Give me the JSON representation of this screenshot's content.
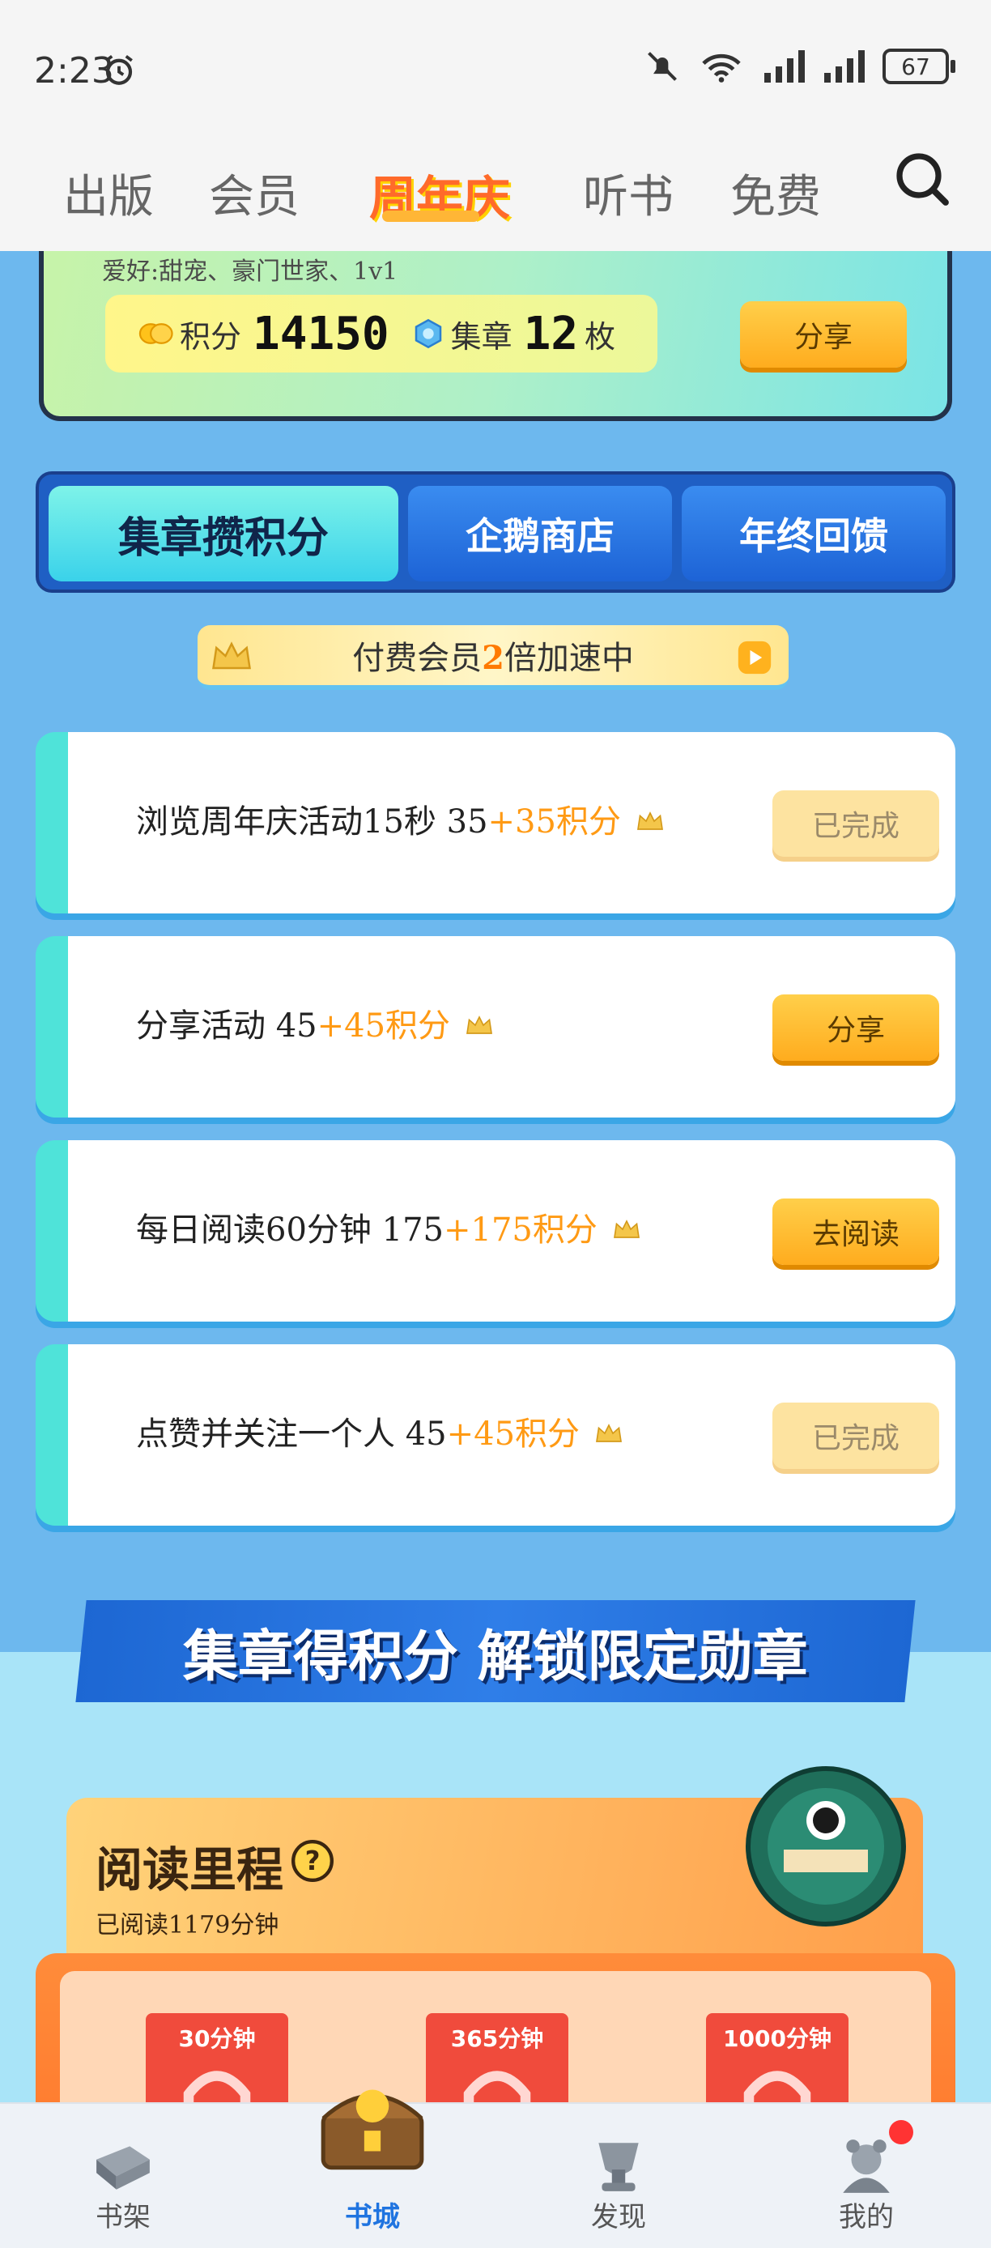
{
  "status_bar": {
    "time": "2:23",
    "battery": "67"
  },
  "top_nav": {
    "items": [
      "出版",
      "会员",
      "周年庆",
      "听书",
      "免费"
    ],
    "active": "周年庆"
  },
  "profile": {
    "hobby": "爱好:甜宠、豪门世家、1v1",
    "points_label": "积分",
    "points_value": "14150",
    "stamps_label": "集章",
    "stamps_value": "12",
    "stamps_unit": "枚",
    "share_label": "分享"
  },
  "tabs": [
    {
      "label": "集章攒积分",
      "active": true
    },
    {
      "label": "企鹅商店",
      "active": false
    },
    {
      "label": "年终回馈",
      "active": false
    }
  ],
  "speed_banner": {
    "prefix": "付费会员",
    "multiplier": "2",
    "suffix": "倍加速中"
  },
  "tasks": [
    {
      "title": "浏览周年庆活动15秒",
      "base": "35",
      "bonus": "+35积分",
      "button": "已完成",
      "status": "done"
    },
    {
      "title": "分享活动",
      "base": "45",
      "bonus": "+45积分",
      "button": "分享",
      "status": "go"
    },
    {
      "title": "每日阅读60分钟",
      "base": "175",
      "bonus": "+175积分",
      "button": "去阅读",
      "status": "go"
    },
    {
      "title": "点赞并关注一个人",
      "base": "45",
      "bonus": "+45积分",
      "button": "已完成",
      "status": "done"
    }
  ],
  "promo": {
    "text": "集章得积分 解锁限定勋章"
  },
  "reading": {
    "title": "阅读里程",
    "subtitle": "已阅读1179分钟",
    "milestones": [
      "30分钟",
      "365分钟",
      "1000分钟"
    ]
  },
  "bottom_nav": {
    "items": [
      "书架",
      "书城",
      "发现",
      "我的"
    ],
    "active": "书城"
  },
  "colors": {
    "accent_orange": "#ff9a14",
    "tab_blue": "#1f5fc4",
    "active_blue": "#1f74e0"
  }
}
